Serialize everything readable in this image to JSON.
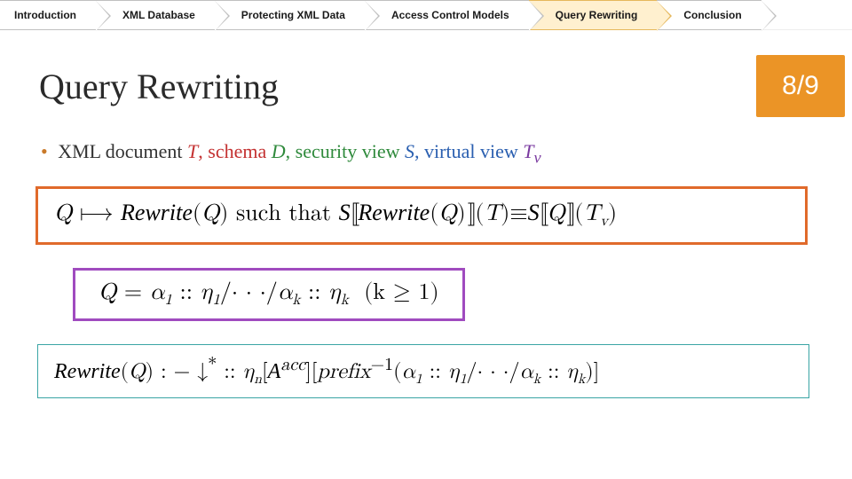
{
  "nav": {
    "items": [
      {
        "label": "Introduction",
        "active": false
      },
      {
        "label": "XML Database",
        "active": false
      },
      {
        "label": "Protecting XML Data",
        "active": false
      },
      {
        "label": "Access Control Models",
        "active": false
      },
      {
        "label": "Query Rewriting",
        "active": true
      },
      {
        "label": "Conclusion",
        "active": false
      }
    ]
  },
  "title": "Query Rewriting",
  "page": {
    "current": 8,
    "total": 9
  },
  "bullet": {
    "prefix": "XML document ",
    "t_var": "T",
    "schema_word": ", schema ",
    "d_var": "D",
    "secview_word": ", security view ",
    "s_var": "S",
    "virtview_word": ", virtual view ",
    "tv_var": "T",
    "tv_sub": "v"
  },
  "formula1": {
    "lhs": "Q",
    "maps": " ⟼ ",
    "rewrite": "Rewrite",
    "such_that": " such that ",
    "S": "S",
    "equiv": "≡",
    "T": "T",
    "Tv": "T",
    "Tv_sub": "v"
  },
  "formula2": {
    "Q": "Q",
    "eq": " = ",
    "alpha": "α",
    "eta": "η",
    "sep": " :: ",
    "slash": "/",
    "dots": "· · ·",
    "k": "k",
    "one": "1",
    "paren": "(k ≥ 1)"
  },
  "formula3": {
    "rewrite": "Rewrite",
    "Q": "Q",
    "assign": " : − ",
    "down": "↓",
    "star": "*",
    "sep": " :: ",
    "eta": "η",
    "n": "n",
    "Acal": "A",
    "acc": "acc",
    "prefix": "prefix",
    "inv": "−1",
    "alpha": "α",
    "one": "1",
    "slash": "/",
    "dots": "· · ·",
    "k": "k"
  }
}
